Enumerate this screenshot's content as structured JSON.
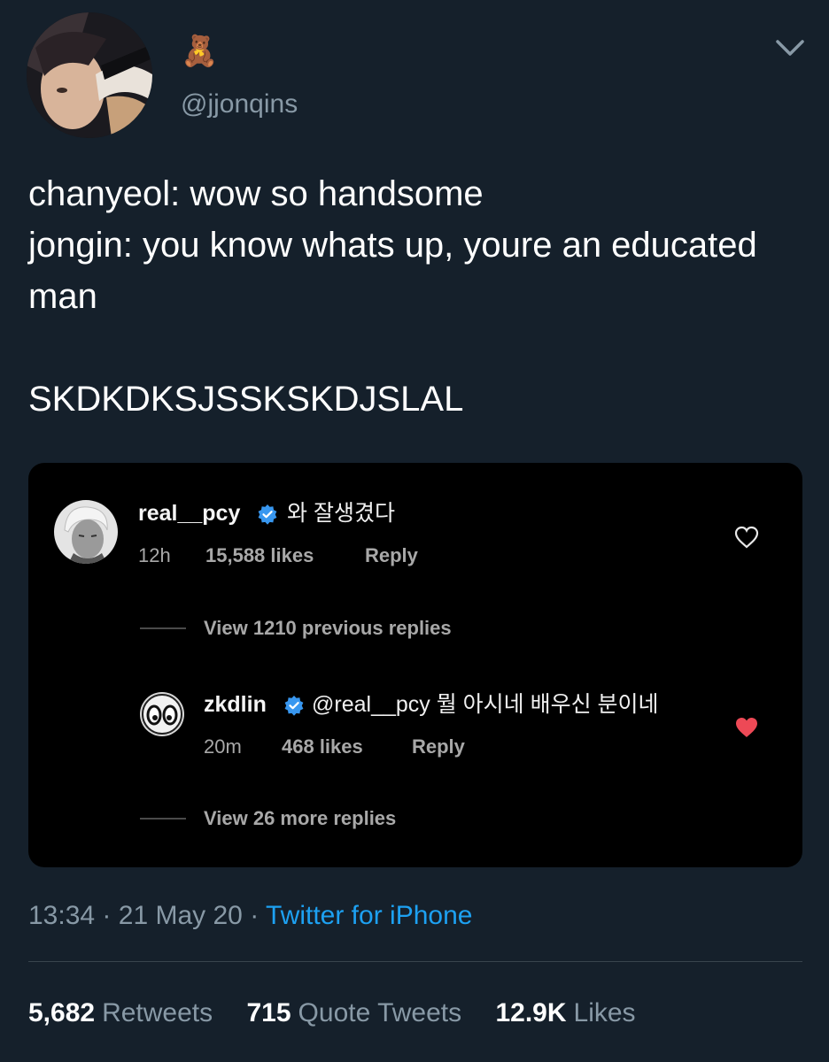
{
  "tweet": {
    "display_name": "🧸",
    "handle": "@jjonqins",
    "text": "chanyeol: wow so handsome\njongin: you know whats up, youre an educated man\n\nSKDKDKSJSSKSKDJSLAL",
    "time": "13:34",
    "separator": "·",
    "date": "21 May 20",
    "source": "Twitter for iPhone"
  },
  "stats": {
    "retweets_count": "5,682",
    "retweets_label": "Retweets",
    "quotes_count": "715",
    "quotes_label": "Quote Tweets",
    "likes_count": "12.9K",
    "likes_label": "Likes"
  },
  "embedded_comments": {
    "comment": {
      "username": "real__pcy",
      "text": "와 잘생겼다",
      "time": "12h",
      "likes": "15,588 likes",
      "reply_label": "Reply"
    },
    "view_previous": "View 1210 previous replies",
    "reply": {
      "username": "zkdlin",
      "text": "@real__pcy 뭘 아시네 배우신 분이네",
      "time": "20m",
      "likes": "468 likes",
      "reply_label": "Reply"
    },
    "view_more": "View 26 more replies"
  },
  "colors": {
    "background": "#15202b",
    "secondary_text": "#8899a6",
    "link": "#1da1f2",
    "liked_heart": "#ed4956",
    "verified": "#3897f0"
  }
}
